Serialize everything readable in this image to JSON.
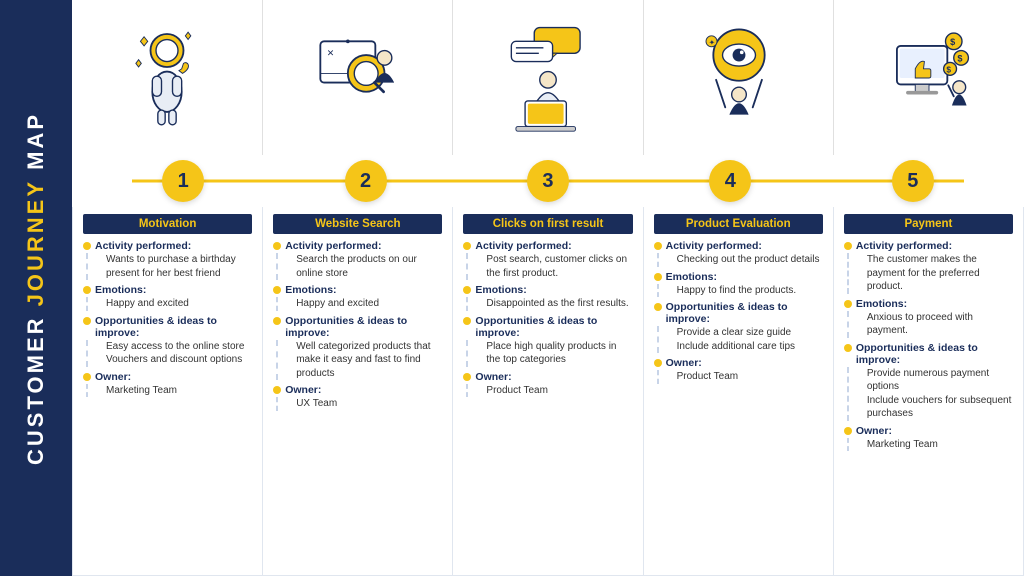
{
  "sidebar": {
    "title_static": "CUSTOMER",
    "title_highlight": "JOURNEY",
    "title_end": "MAP"
  },
  "steps": [
    {
      "number": "1"
    },
    {
      "number": "2"
    },
    {
      "number": "3"
    },
    {
      "number": "4"
    },
    {
      "number": "5"
    }
  ],
  "cards": [
    {
      "title": "Motivation",
      "activity_label": "Activity performed:",
      "activity_text": "Wants to purchase a birthday present for her best friend",
      "emotions_label": "Emotions:",
      "emotions_text": "Happy and excited",
      "opportunities_label": "Opportunities & ideas to improve:",
      "opportunities_text": "Easy access to the online store\nVouchers and discount options",
      "owner_label": "Owner:",
      "owner_text": "Marketing Team"
    },
    {
      "title": "Website Search",
      "activity_label": "Activity performed:",
      "activity_text": "Search the products on our online store",
      "emotions_label": "Emotions:",
      "emotions_text": "Happy and excited",
      "opportunities_label": "Opportunities & ideas to improve:",
      "opportunities_text": "Well categorized products that make it easy and fast to find products",
      "owner_label": "Owner:",
      "owner_text": "UX Team"
    },
    {
      "title": "Clicks on first result",
      "activity_label": "Activity performed:",
      "activity_text": "Post search, customer clicks on the first product.",
      "emotions_label": "Emotions:",
      "emotions_text": "Disappointed as the first results.",
      "opportunities_label": "Opportunities & ideas to improve:",
      "opportunities_text": "Place high quality products in the top categories",
      "owner_label": "Owner:",
      "owner_text": "Product Team"
    },
    {
      "title": "Product Evaluation",
      "activity_label": "Activity performed:",
      "activity_text": "Checking out the product details",
      "emotions_label": "Emotions:",
      "emotions_text": "Happy to find the products.",
      "opportunities_label": "Opportunities & ideas to improve:",
      "opportunities_text": "Provide a clear size guide\nInclude additional care tips",
      "owner_label": "Owner:",
      "owner_text": "Product Team"
    },
    {
      "title": "Payment",
      "activity_label": "Activity performed:",
      "activity_text": "The customer makes the payment for the preferred product.",
      "emotions_label": "Emotions:",
      "emotions_text": "Anxious to proceed with payment.",
      "opportunities_label": "Opportunities & ideas to improve:",
      "opportunities_text": "Provide numerous payment options\nInclude vouchers for subsequent purchases",
      "owner_label": "Owner:",
      "owner_text": "Marketing Team"
    }
  ]
}
